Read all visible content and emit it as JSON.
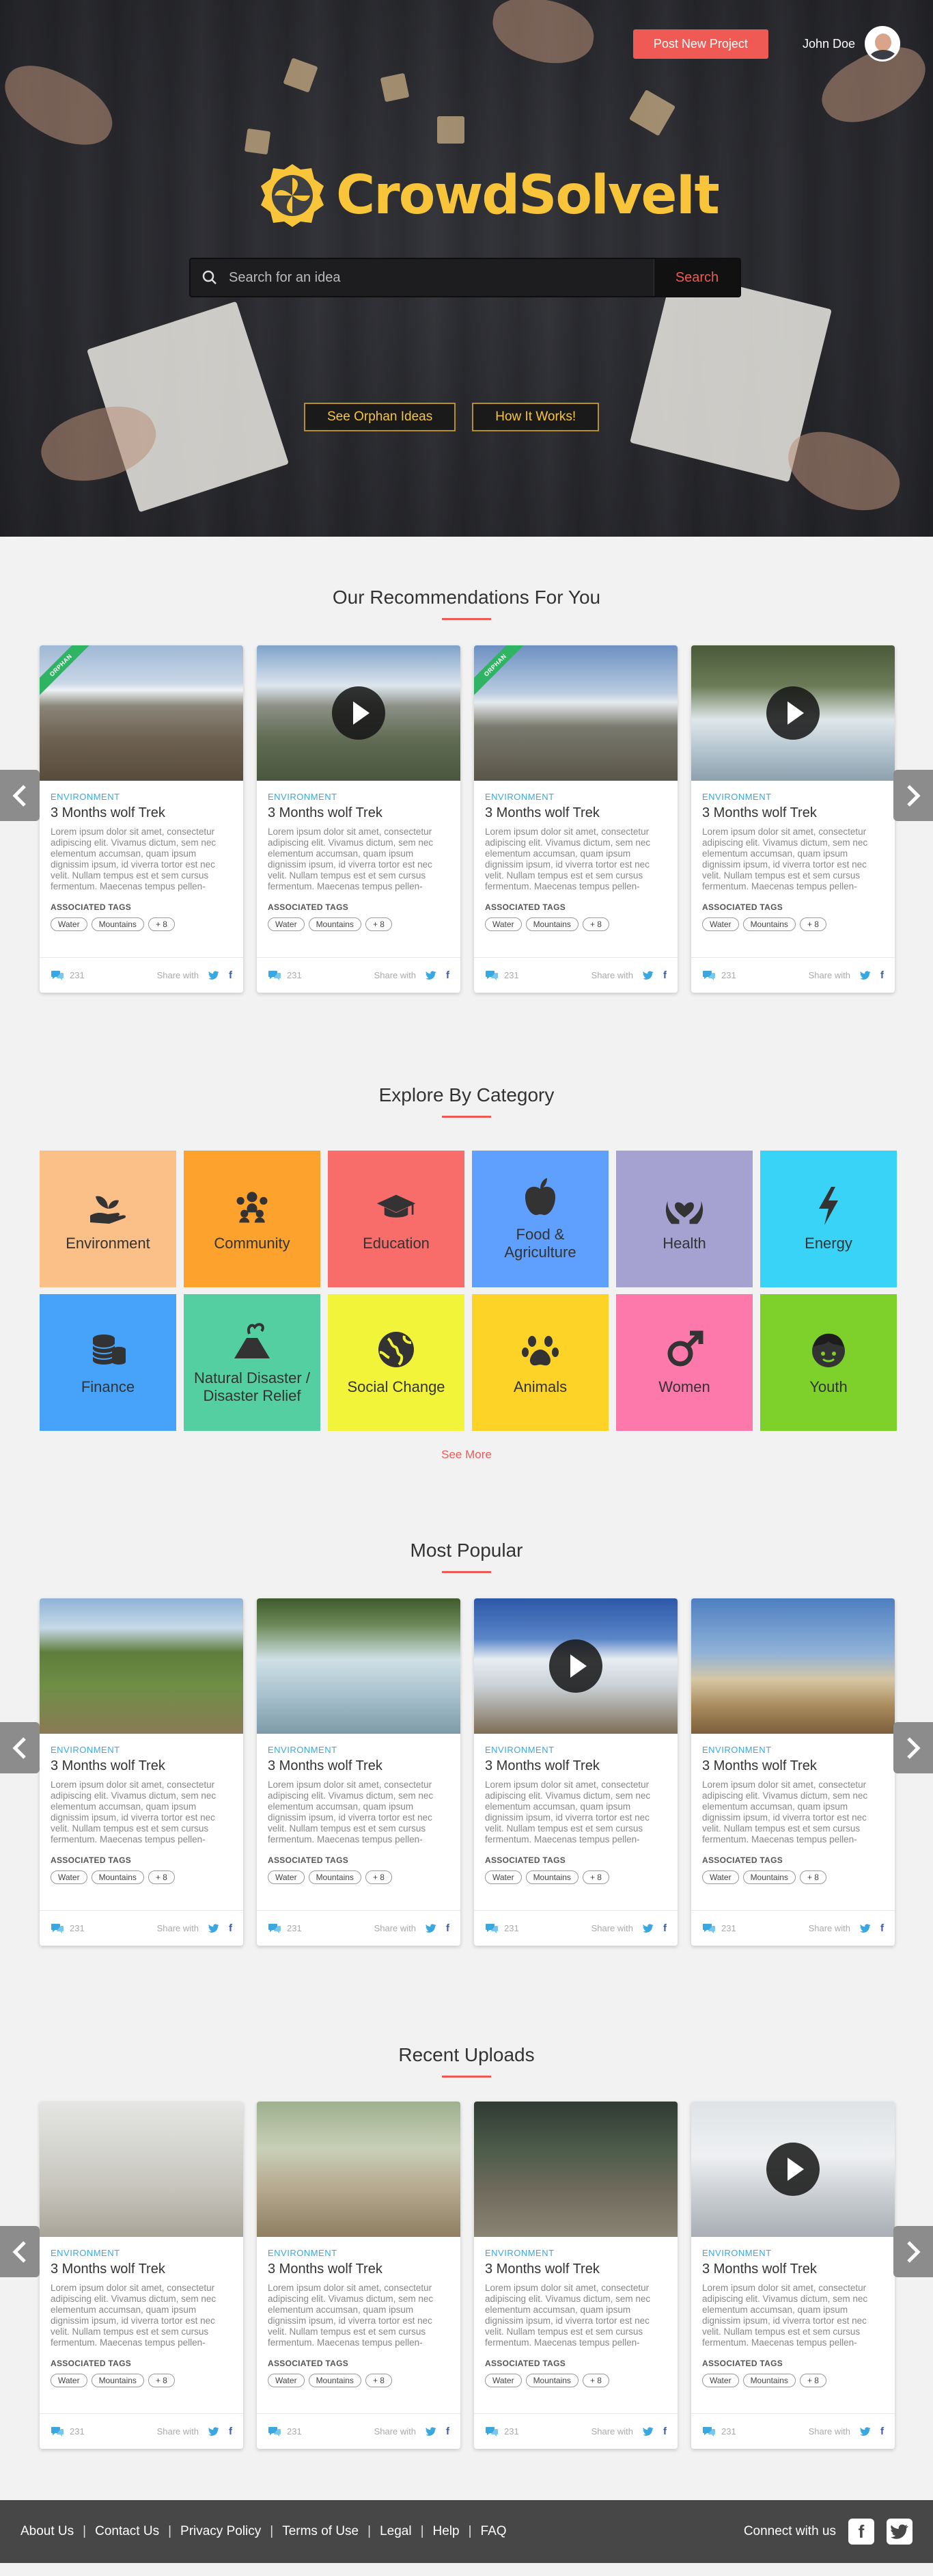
{
  "header": {
    "post_button": "Post New Project",
    "user_name": "John Doe",
    "logo_text": "CrowdSolveIt",
    "search_placeholder": "Search for an idea",
    "search_button": "Search",
    "orphan_button": "See Orphan Ideas",
    "how_button": "How It Works!"
  },
  "card_template": {
    "category": "ENVIRONMENT",
    "title": "3 Months wolf Trek",
    "description": "Lorem ipsum dolor sit amet, consectetur adipiscing elit. Vivamus dictum, sem nec elementum accumsan, quam ipsum dignissim ipsum, id viverra tortor est nec velit. Nullam tempus est et sem cursus fermentum. Maecenas tempus pellen-tesque eros ut accumsan...",
    "tags_label": "ASSOCIATED TAGS",
    "tags": [
      "Water",
      "Mountains",
      "+ 8"
    ],
    "comments": "231",
    "share_label": "Share with"
  },
  "sections": {
    "recommendations": {
      "title": "Our Recommendations For You",
      "cards": [
        {
          "image": "mountain-hikers",
          "ribbon": "ORPHAN",
          "video": false
        },
        {
          "image": "tents-mountains",
          "ribbon": "",
          "video": true
        },
        {
          "image": "hikers-ridge",
          "ribbon": "ORPHAN",
          "video": false
        },
        {
          "image": "rafting",
          "ribbon": "",
          "video": true
        }
      ]
    },
    "categories": {
      "title": "Explore By Category",
      "items": [
        {
          "label": "Environment",
          "icon": "plant-hand-icon",
          "color": "#fbbf88"
        },
        {
          "label": "Community",
          "icon": "people-group-icon",
          "color": "#fca22d"
        },
        {
          "label": "Education",
          "icon": "graduation-cap-icon",
          "color": "#f86c6a"
        },
        {
          "label": "Food & Agriculture",
          "icon": "apple-icon",
          "color": "#5fa0ff"
        },
        {
          "label": "Health",
          "icon": "heart-hands-icon",
          "color": "#a5a1d1"
        },
        {
          "label": "Energy",
          "icon": "lightning-icon",
          "color": "#39d3f8"
        },
        {
          "label": "Finance",
          "icon": "coins-icon",
          "color": "#47a3fa"
        },
        {
          "label": "Natural Disaster / Disaster Relief",
          "icon": "volcano-icon",
          "color": "#53cfa2"
        },
        {
          "label": "Social Change",
          "icon": "globe-icon",
          "color": "#f2f43a"
        },
        {
          "label": "Animals",
          "icon": "paw-icon",
          "color": "#fdd328"
        },
        {
          "label": "Women",
          "icon": "female-symbol-icon",
          "color": "#fd79ac"
        },
        {
          "label": "Youth",
          "icon": "child-face-icon",
          "color": "#7dd12a"
        }
      ],
      "see_more": "See More"
    },
    "popular": {
      "title": "Most Popular",
      "cards": [
        {
          "image": "mountain-bikers",
          "ribbon": "",
          "video": false
        },
        {
          "image": "rafting-group",
          "ribbon": "",
          "video": false
        },
        {
          "image": "snow-biker",
          "ribbon": "",
          "video": true
        },
        {
          "image": "desert-biker",
          "ribbon": "",
          "video": false
        }
      ]
    },
    "recent": {
      "title": "Recent Uploads",
      "cards": [
        {
          "image": "trekkers-line",
          "ribbon": "",
          "video": false
        },
        {
          "image": "bikers-trail",
          "ribbon": "",
          "video": false
        },
        {
          "image": "cyclists-race",
          "ribbon": "",
          "video": false
        },
        {
          "image": "snow-sled",
          "ribbon": "",
          "video": true
        }
      ]
    }
  },
  "footer": {
    "links": [
      "About Us",
      "Contact Us",
      "Privacy Policy",
      "Terms of Use",
      "Legal",
      "Help",
      "FAQ"
    ],
    "connect_label": "Connect with us",
    "social": [
      "facebook-icon",
      "twitter-icon"
    ]
  },
  "colors": {
    "accent": "#f05a55",
    "logo": "#f8c53a",
    "category_text": "#3aa8e0",
    "ribbon": "#2fb463",
    "footer": "#474747"
  }
}
